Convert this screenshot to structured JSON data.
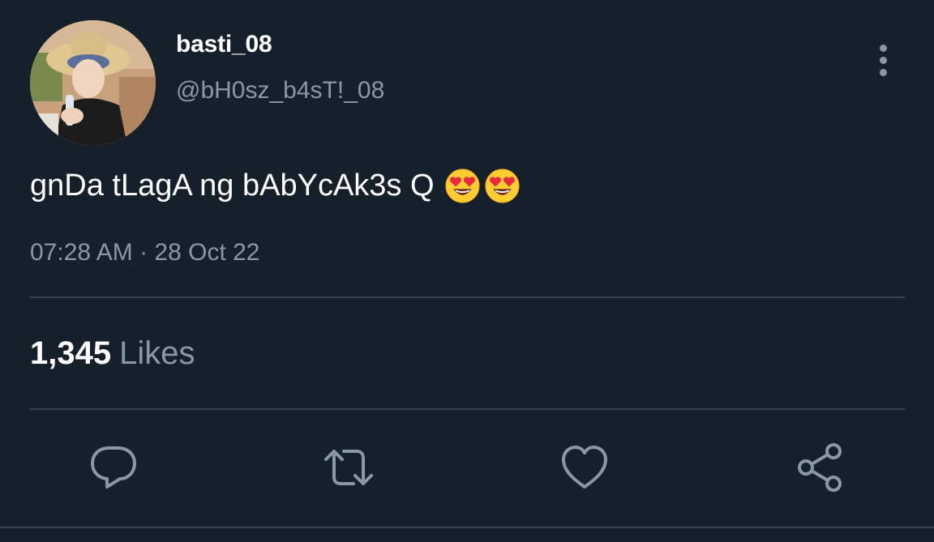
{
  "tweet": {
    "display_name": "basti_08",
    "handle": "@bH0sz_b4sT!_08",
    "text": "gnDa tLagA ng bAbYcAk3s Q",
    "emojis": [
      "heart-eyes-emoji",
      "heart-eyes-emoji"
    ],
    "timestamp": "07:28 AM · 28 Oct 22",
    "likes_count": "1,345",
    "likes_label": "Likes"
  },
  "icons": {
    "more": "more-vertical-icon",
    "reply": "reply-icon",
    "retweet": "retweet-icon",
    "like": "heart-icon",
    "share": "share-icon"
  },
  "colors": {
    "background": "#15202b",
    "secondary_text": "#8899a6",
    "divider": "#38444d",
    "primary_text": "#ffffff"
  }
}
